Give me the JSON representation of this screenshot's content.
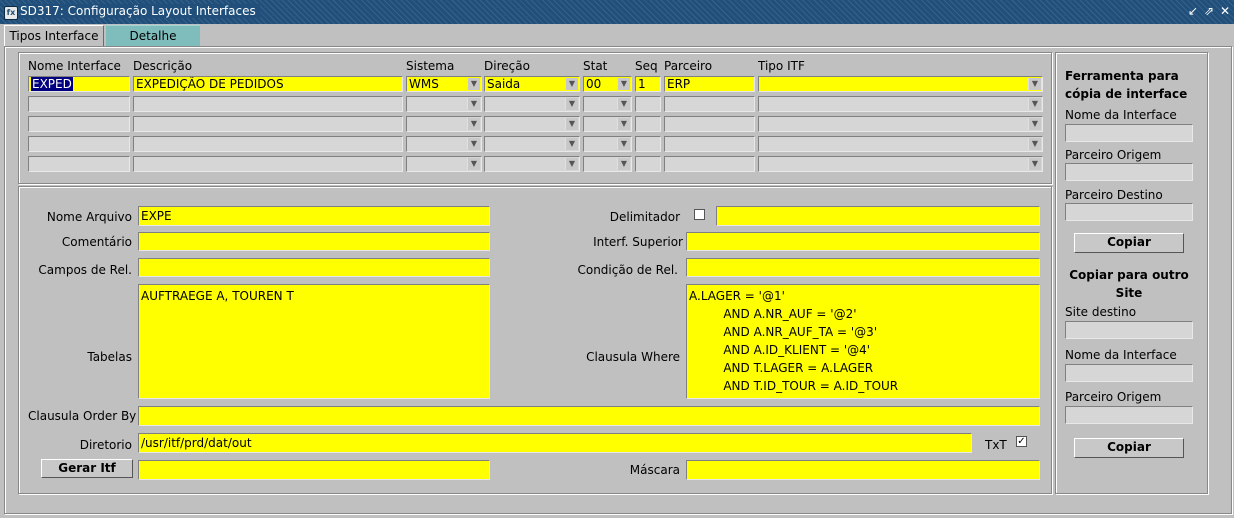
{
  "window": {
    "title": "SD317: Configuração Layout Interfaces",
    "icon": "app-icon",
    "controls": [
      "restore-icon",
      "maximize-icon",
      "close-icon"
    ]
  },
  "tabs": [
    {
      "label": "Tipos Interface",
      "active": true
    },
    {
      "label": "Detalhe",
      "active": false
    }
  ],
  "grid": {
    "headers": [
      "Nome Interface",
      "Descrição",
      "Sistema",
      "Direção",
      "Stat",
      "Seq",
      "Parceiro",
      "Tipo ITF"
    ],
    "rows": [
      {
        "nome": "EXPED",
        "descricao": "EXPEDIÇÃO DE PEDIDOS",
        "sistema": "WMS",
        "direcao": "Saida",
        "stat": "00",
        "seq": "1",
        "parceiro": "ERP",
        "tipo": ""
      },
      {
        "nome": "",
        "descricao": "",
        "sistema": "",
        "direcao": "",
        "stat": "",
        "seq": "",
        "parceiro": "",
        "tipo": ""
      },
      {
        "nome": "",
        "descricao": "",
        "sistema": "",
        "direcao": "",
        "stat": "",
        "seq": "",
        "parceiro": "",
        "tipo": ""
      },
      {
        "nome": "",
        "descricao": "",
        "sistema": "",
        "direcao": "",
        "stat": "",
        "seq": "",
        "parceiro": "",
        "tipo": ""
      },
      {
        "nome": "",
        "descricao": "",
        "sistema": "",
        "direcao": "",
        "stat": "",
        "seq": "",
        "parceiro": "",
        "tipo": ""
      }
    ]
  },
  "detail": {
    "labels": {
      "nome_arquivo": "Nome Arquivo",
      "comentario": "Comentário",
      "campos_rel": "Campos de Rel.",
      "tabelas": "Tabelas",
      "order_by": "Clausula Order By",
      "diretorio": "Diretorio",
      "delimitador": "Delimitador",
      "interf_superior": "Interf. Superior",
      "condicao_rel": "Condição de Rel.",
      "clausula_where": "Clausula Where",
      "txt": "TxT",
      "mascara": "Máscara"
    },
    "values": {
      "nome_arquivo": "EXPE",
      "comentario": "",
      "campos_rel": "",
      "tabelas": "AUFTRAEGE A, TOUREN T",
      "order_by": "",
      "diretorio": "/usr/itf/prd/dat/out",
      "delimitador": "",
      "interf_superior": "",
      "condicao_rel": "",
      "clausula_where": "A.LAGER = '@1'\n         AND A.NR_AUF = '@2'\n         AND A.NR_AUF_TA = '@3'\n         AND A.ID_KLIENT = '@4'\n         AND T.LAGER = A.LAGER\n         AND T.ID_TOUR = A.ID_TOUR",
      "gerar_itf_field": "",
      "mascara": ""
    },
    "delimitador_checked": false,
    "txt_checked": true,
    "gerar_itf_label": "Gerar Itf"
  },
  "sidebar": {
    "tool_title": "Ferramenta para\ncópia de interface",
    "nome_interface_label": "Nome da Interface",
    "parceiro_origem_label": "Parceiro Origem",
    "parceiro_destino_label": "Parceiro Destino",
    "copiar_label": "Copiar",
    "site_title": "Copiar para outro\nSite",
    "site_destino_label": "Site destino",
    "nome_interface2_label": "Nome da Interface",
    "parceiro_origem2_label": "Parceiro Origem",
    "copiar2_label": "Copiar",
    "values": {
      "nome_interface": "",
      "parceiro_origem": "",
      "parceiro_destino": "",
      "site_destino": "",
      "nome_interface2": "",
      "parceiro_origem2": ""
    }
  },
  "colors": {
    "required_field": "#ffff00",
    "title_bar": "#1f4f7a",
    "inactive_tab": "#7fbdbd",
    "background": "#c0c0c0"
  }
}
